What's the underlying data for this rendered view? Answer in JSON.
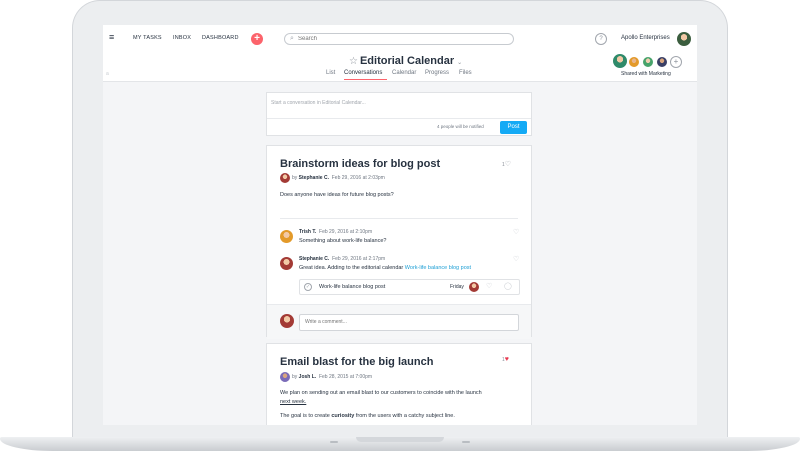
{
  "topbar": {
    "menu_glyph": "≡",
    "nav": [
      "MY TASKS",
      "INBOX",
      "DASHBOARD"
    ],
    "add_glyph": "+",
    "search_placeholder": "Search",
    "help_glyph": "?",
    "org": "Apollo Enterprises"
  },
  "project": {
    "title": "Editorial Calendar",
    "star_glyph": "☆",
    "chevron_glyph": "⌄",
    "tabs": [
      "List",
      "Conversations",
      "Calendar",
      "Progress",
      "Files"
    ],
    "active_tab": "Conversations",
    "shared_label": "Shared with Marketing",
    "members_add_glyph": "+",
    "corner_glyph": "a"
  },
  "composer": {
    "placeholder": "Start a conversation in Editorial Calendar...",
    "notify": "4 people will be notified",
    "post_label": "Post"
  },
  "threads": [
    {
      "title": "Brainstorm ideas for blog post",
      "likes": "1",
      "author": "Stephanie C.",
      "date": "Feb 29, 2016 at 2:03pm",
      "body": "Does anyone have ideas for future blog posts?",
      "comments": [
        {
          "author": "Trish T.",
          "date": "Feb 29, 2016 at 2:10pm",
          "text": "Something about work-life balance?"
        },
        {
          "author": "Stephanie C.",
          "date": "Feb 29, 2016 at 2:17pm",
          "text": "Great idea. Adding to the editorial calendar ",
          "link": "Work-life balance blog post"
        }
      ],
      "task": {
        "name": "Work-life balance blog post",
        "due": "Friday"
      },
      "comment_placeholder": "Write a comment..."
    },
    {
      "title": "Email blast for the big launch",
      "likes": "1",
      "author": "Josh L.",
      "date": "Feb 28, 2015 at 7:00pm",
      "body1": "We plan on sending out an email blast to our customers to coincide with the launch",
      "body1b": "next week.",
      "body2a": "The goal is to create ",
      "body2b": "curiosity",
      "body2c": " from the users with a catchy subject line."
    }
  ],
  "by_word": "by",
  "colors": {
    "accent": "#14aaf5",
    "brand_coral": "#fc636b",
    "heart_red": "#e8384f",
    "link": "#1e9fd5"
  },
  "icons": {
    "heart": "♡",
    "heart_filled": "♥",
    "check": "✓",
    "comment": "◯",
    "search": "⌕"
  }
}
